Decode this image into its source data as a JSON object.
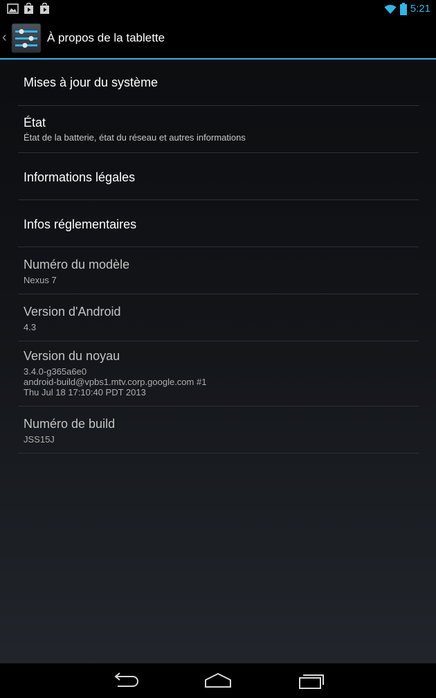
{
  "status_bar": {
    "left_icons": [
      "gallery-icon",
      "play-store-icon",
      "play-store-icon"
    ],
    "right_icons": [
      "wifi-icon",
      "battery-icon"
    ],
    "time": "5:21",
    "accent_color": "#33b5e5"
  },
  "action_bar": {
    "title": "À propos de la tablette",
    "icon": "settings-sliders-icon"
  },
  "list": {
    "items": [
      {
        "title": "Mises à jour du système"
      },
      {
        "title": "État",
        "summary": "État de la batterie, état du réseau et autres informations"
      },
      {
        "title": "Informations légales"
      },
      {
        "title": "Infos réglementaires"
      },
      {
        "title": "Numéro du modèle",
        "summary": "Nexus 7"
      },
      {
        "title": "Version d'Android",
        "summary": "4.3"
      },
      {
        "title": "Version du noyau",
        "summary_lines": [
          "3.4.0-g365a6e0",
          "android-build@vpbs1.mtv.corp.google.com #1",
          "Thu Jul 18 17:10:40 PDT 2013"
        ]
      },
      {
        "title": "Numéro de build",
        "summary": "JSS15J"
      }
    ]
  },
  "nav_bar": {
    "buttons": [
      "back-icon",
      "home-icon",
      "recent-apps-icon"
    ]
  }
}
